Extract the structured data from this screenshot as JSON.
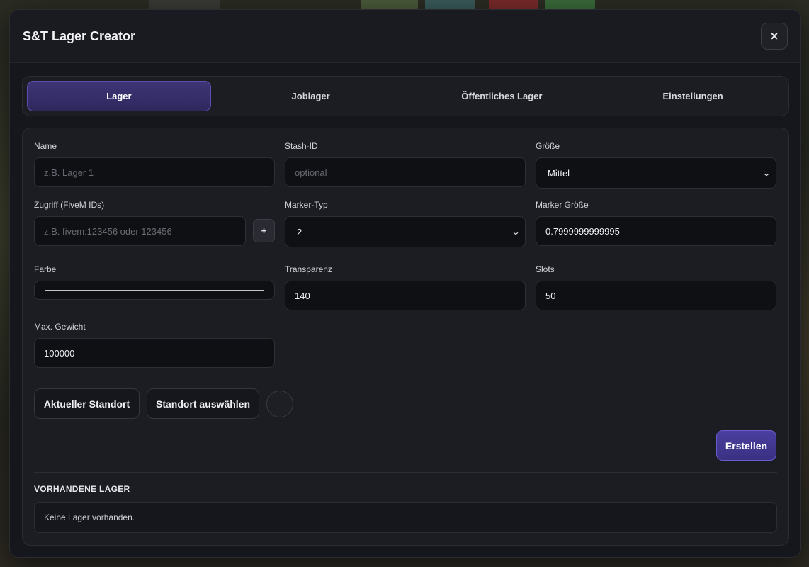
{
  "header": {
    "title": "S&T Lager Creator",
    "close_label": "×"
  },
  "tabs": [
    {
      "label": "Lager",
      "active": true
    },
    {
      "label": "Joblager",
      "active": false
    },
    {
      "label": "Öffentliches Lager",
      "active": false
    },
    {
      "label": "Einstellungen",
      "active": false
    }
  ],
  "form": {
    "name": {
      "label": "Name",
      "placeholder": "z.B. Lager 1",
      "value": ""
    },
    "stash_id": {
      "label": "Stash-ID",
      "placeholder": "optional",
      "value": ""
    },
    "size": {
      "label": "Größe",
      "value": "Mittel"
    },
    "access": {
      "label": "Zugriff (FiveM IDs)",
      "placeholder": "z.B. fivem:123456 oder 123456",
      "add_label": "+"
    },
    "marker_type": {
      "label": "Marker-Typ",
      "value": "2"
    },
    "marker_size": {
      "label": "Marker Größe",
      "value": "0.7999999999995"
    },
    "color": {
      "label": "Farbe",
      "value": "#c4c4c8"
    },
    "transparency": {
      "label": "Transparenz",
      "value": "140"
    },
    "slots": {
      "label": "Slots",
      "value": "50"
    },
    "max_weight": {
      "label": "Max. Gewicht",
      "value": "100000"
    }
  },
  "actions": {
    "current_location": "Aktueller Standort",
    "pick_location": "Standort auswählen",
    "location_status": "—",
    "create": "Erstellen"
  },
  "existing": {
    "title": "VORHANDENE LAGER",
    "empty_text": "Keine Lager vorhanden."
  },
  "colors": {
    "accent": "#3d3576",
    "accent_border": "#5a4fb0",
    "modal_bg": "#16171c",
    "input_bg": "#0f1014"
  }
}
